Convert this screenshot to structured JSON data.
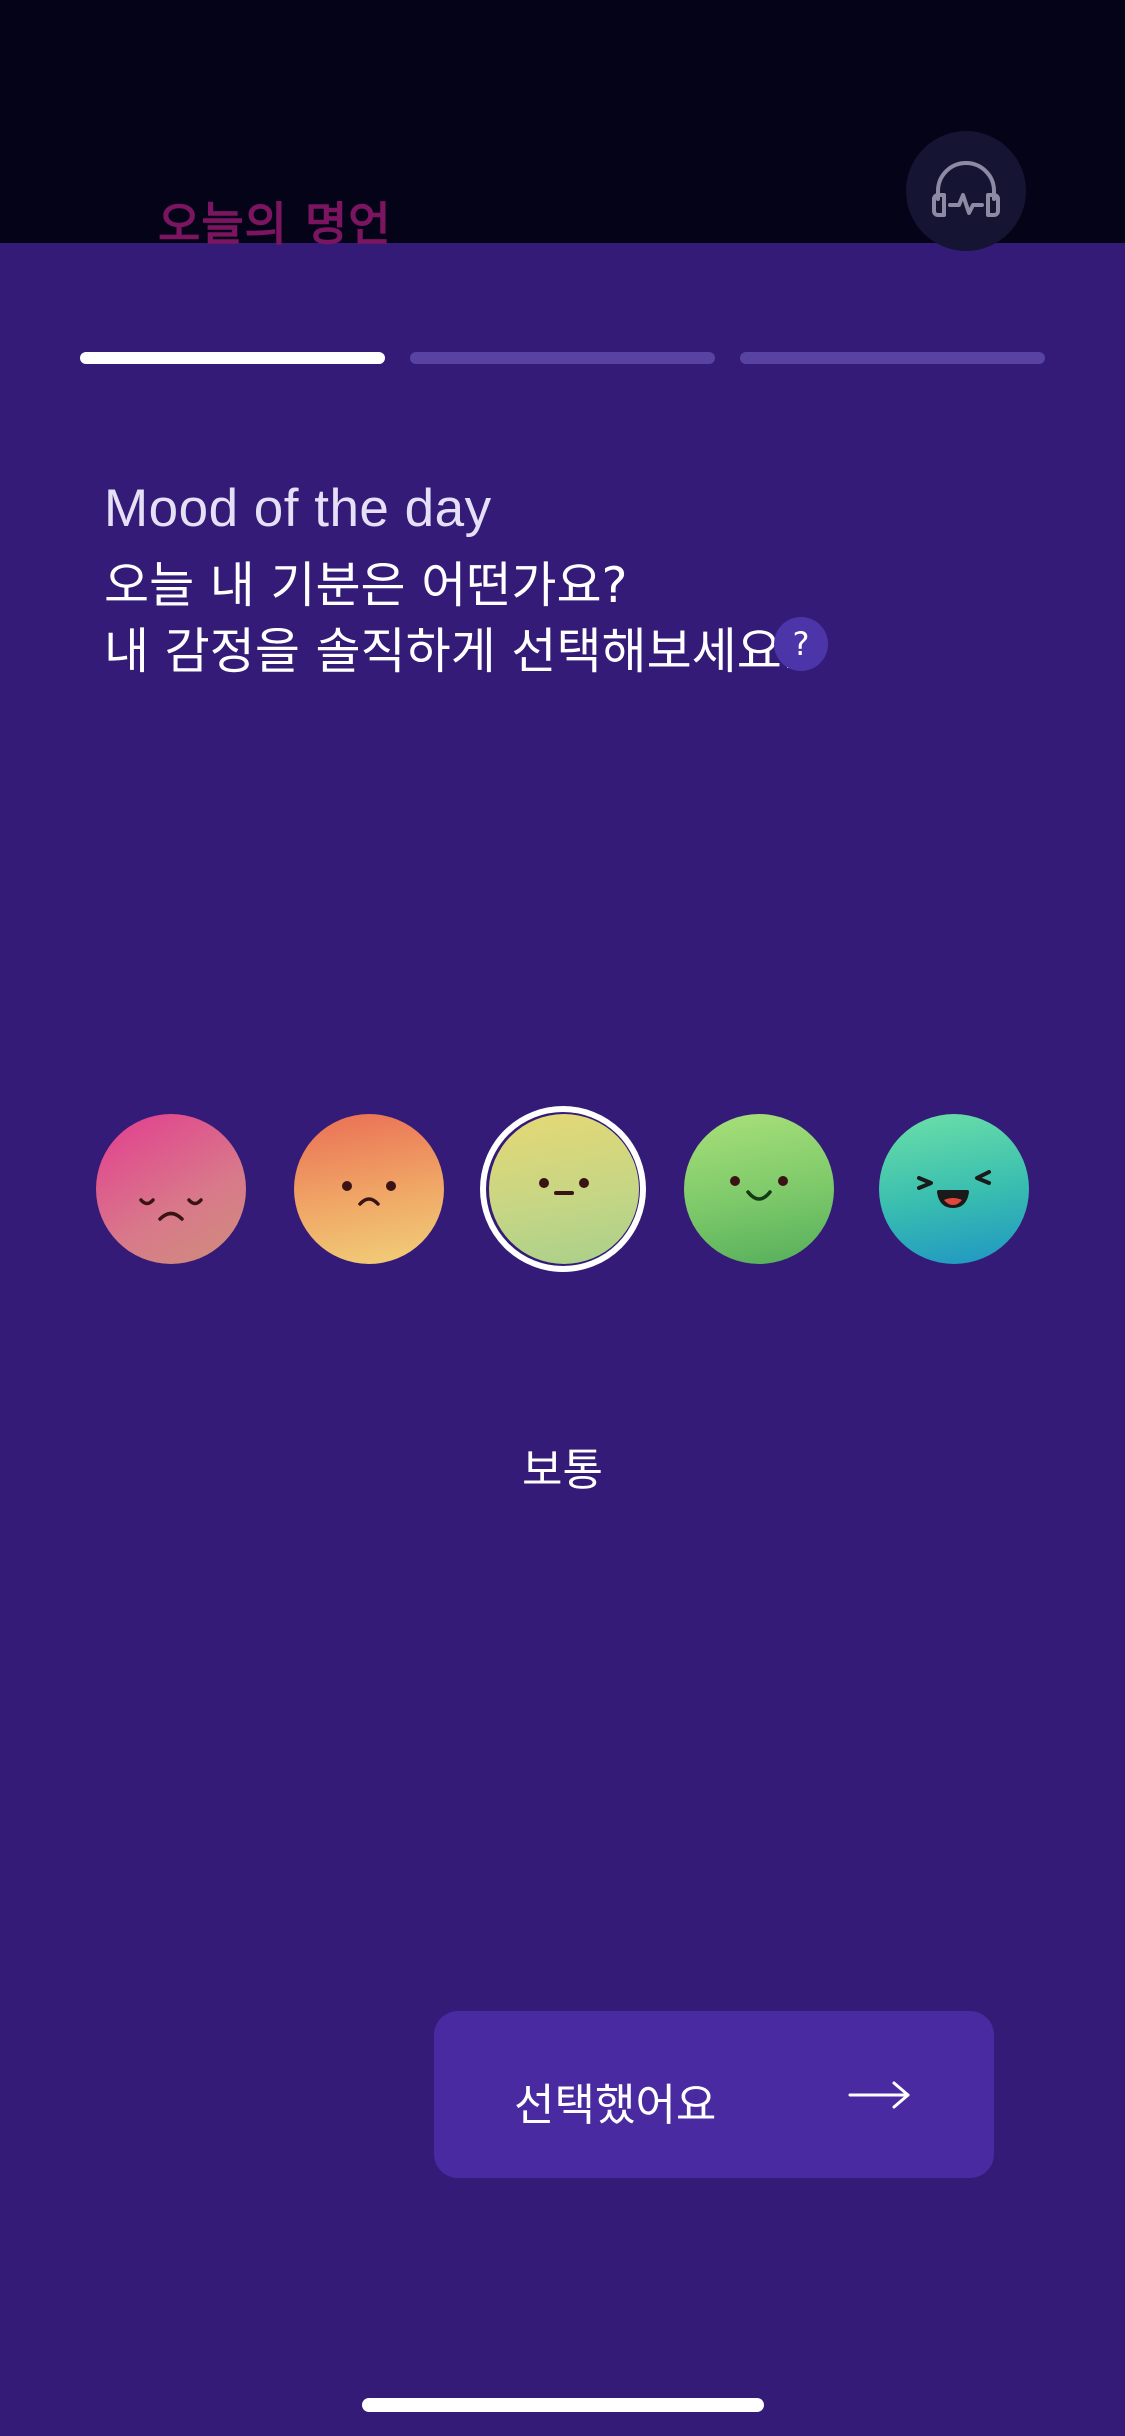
{
  "header": {
    "quote_title": "오늘의 명언",
    "audio_icon": "headphones-pulse-icon"
  },
  "progress": {
    "current_step": 1,
    "total_steps": 3
  },
  "heading": {
    "english": "Mood of the day",
    "line1": "오늘 내 기분은 어떤가요?",
    "line2": "내 감정을 솔직하게 선택해보세요.",
    "help_label": "?"
  },
  "moods": {
    "selected_index": 2,
    "selected_label": "보통",
    "faces": [
      {
        "icon": "sad-face-icon",
        "color": "#e33c8f"
      },
      {
        "icon": "frown-face-icon",
        "color": "#ea6e55"
      },
      {
        "icon": "neutral-face-icon",
        "color": "#e6d874"
      },
      {
        "icon": "smile-face-icon",
        "color": "#7dc96a"
      },
      {
        "icon": "laughing-face-icon",
        "color": "#38bdb0"
      }
    ]
  },
  "cta": {
    "label": "선택했어요",
    "arrow_icon": "arrow-right-icon"
  },
  "colors": {
    "background": "#341b78",
    "top_bar": "#040317",
    "button": "#4a2aa0",
    "progress_active": "#ffffff",
    "progress_inactive": "#5843a3"
  }
}
